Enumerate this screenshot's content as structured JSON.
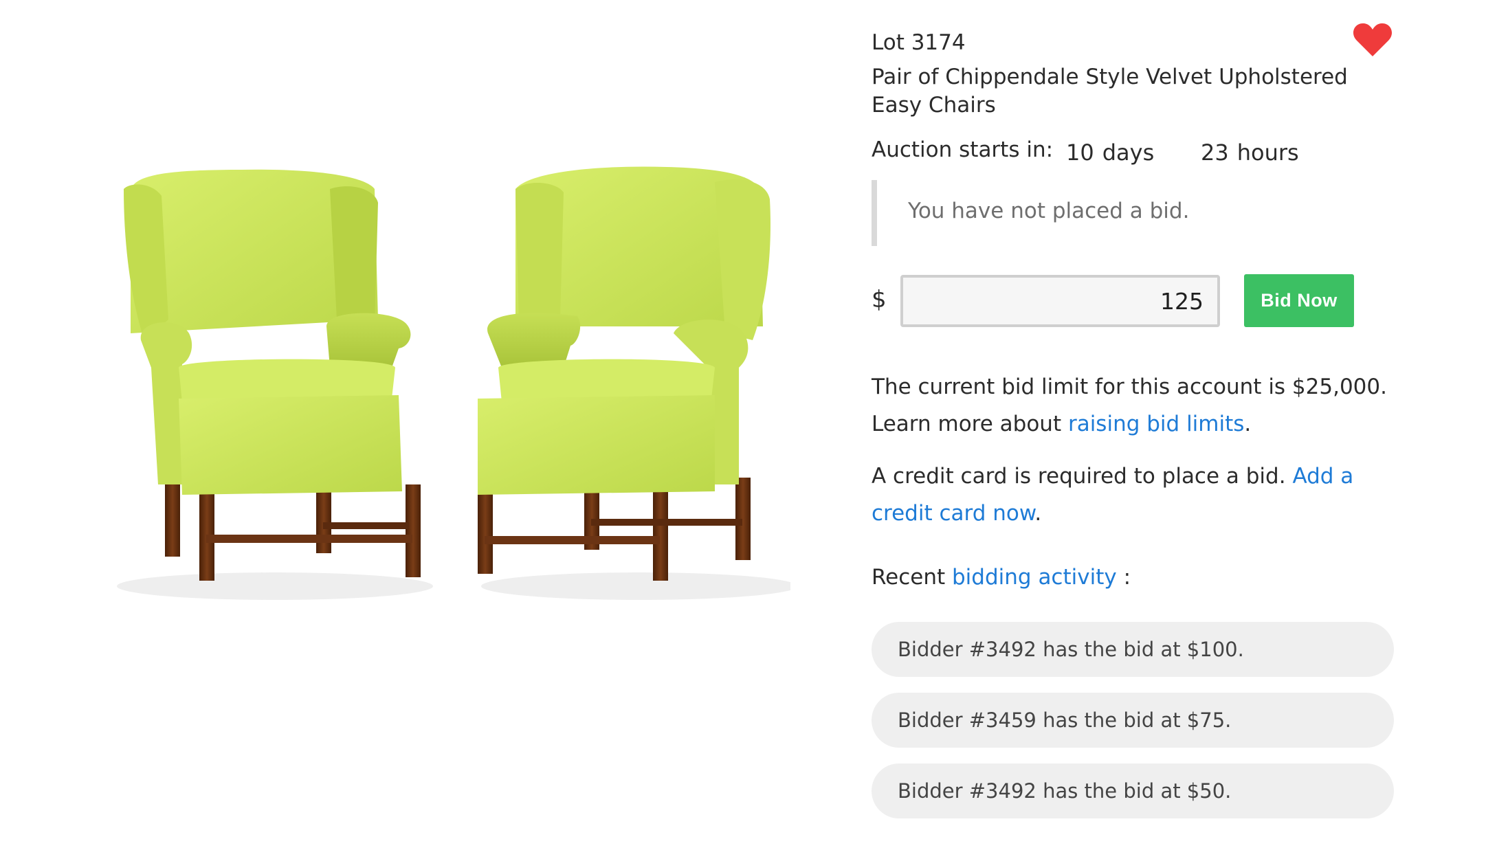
{
  "lot": {
    "number_label": "Lot 3174",
    "title": "Pair of Chippendale Style Velvet Upholstered Easy Chairs",
    "image_alt": "Pair of lime green wingback easy chairs with mahogany legs",
    "favorited": true,
    "favorite_color": "#ef3b3b"
  },
  "auction": {
    "starts_label": "Auction starts in:",
    "days_value": "10",
    "days_unit": "days",
    "hours_value": "23",
    "hours_unit": "hours"
  },
  "bid_status": {
    "message": "You have not placed a bid."
  },
  "bid_form": {
    "currency_symbol": "$",
    "amount": "125",
    "button_label": "Bid Now",
    "button_color": "#3cc063"
  },
  "limits": {
    "text": "The current bid limit for this account is $25,000.",
    "learn_prefix": "Learn more about ",
    "learn_link": "raising bid limits",
    "learn_suffix": "."
  },
  "credit_card": {
    "text": "A credit card is required to place a bid. ",
    "link": "Add a credit card now",
    "suffix": "."
  },
  "recent": {
    "prefix": "Recent ",
    "link": "bidding activity",
    "suffix": " :"
  },
  "activity": [
    {
      "text": "Bidder #3492 has the bid at $100."
    },
    {
      "text": "Bidder #3459 has the bid at $75."
    },
    {
      "text": "Bidder #3492 has the bid at $50."
    }
  ],
  "colors": {
    "link": "#1e7bd6",
    "chair_upholstery": "#cde65c",
    "chair_wood": "#6b3414"
  }
}
